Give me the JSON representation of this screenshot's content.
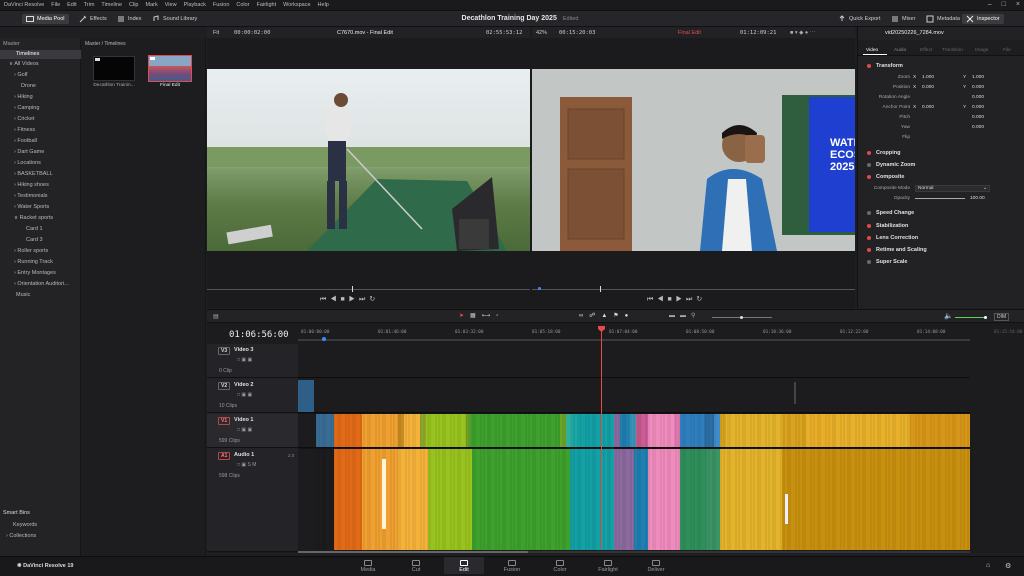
{
  "app": {
    "name": "DaVinci Resolve"
  },
  "menu": [
    "DaVinci Resolve",
    "File",
    "Edit",
    "Trim",
    "Timeline",
    "Clip",
    "Mark",
    "View",
    "Playback",
    "Fusion",
    "Color",
    "Fairlight",
    "Workspace",
    "Help"
  ],
  "toolbar": {
    "media_pool": "Media Pool",
    "effects": "Effects",
    "index": "Index",
    "sound_library": "Sound Library",
    "quick_export": "Quick Export",
    "mixer": "Mixer",
    "metadata": "Metadata",
    "inspector": "Inspector"
  },
  "project": {
    "title": "Decathlon Training Day 2025",
    "status": "Edited"
  },
  "leftpanel": {
    "header": "Master",
    "items": [
      "Timelines",
      "All Videos",
      "Golf",
      "Drone",
      "Hiking",
      "Camping",
      "Cricket",
      "Fitness",
      "Football",
      "Dart Game",
      "Locations",
      "BASKETBALL",
      "Hiking shoes",
      "Testimonials",
      "Water Sports",
      "Racket sports",
      "Card 1",
      "Card 3",
      "Roller sports",
      "Running Track",
      "Entry Montages",
      "Orientation Auditori...",
      "Music"
    ],
    "smart_bins": "Smart Bins",
    "smart_items": [
      "Keywords",
      "Collections"
    ]
  },
  "mediapool": {
    "breadcrumb": "Master / Timelines",
    "clips": [
      "Decathlon Trainin...",
      "Final Edit"
    ]
  },
  "source_viewer": {
    "zoom": "Fit",
    "timecode_left": "00:00:02:00",
    "clip_name": "C7670.mov - Final Edit",
    "timecode_right": "02:55:53:12"
  },
  "timeline_viewer": {
    "zoom": "42%",
    "timecode_left": "00:15:20:03",
    "timeline_name": "Final Edit",
    "timecode_right": "01:12:09:21"
  },
  "poster_text": [
    "WATE",
    "ECOS",
    "2025"
  ],
  "inspector": {
    "filename": "vid20250226_7284.mov",
    "tabs": [
      "Video",
      "Audio",
      "Effect",
      "Transition",
      "Image",
      "File"
    ],
    "sections": [
      "Transform",
      "Cropping",
      "Dynamic Zoom",
      "Composite",
      "Speed Change",
      "Stabilization",
      "Lens Correction",
      "Retime and Scaling",
      "Super Scale"
    ],
    "transform": {
      "zoom_label": "Zoom",
      "zoom_x": "1.000",
      "zoom_y": "1.000",
      "position_label": "Position",
      "pos_x": "0.000",
      "pos_y": "0.000",
      "rotation_label": "Rotation Angle",
      "rotation": "0.000",
      "anchor_label": "Anchor Point",
      "anchor_x": "0.000",
      "anchor_y": "0.000",
      "pitch_label": "Pitch",
      "pitch": "0.000",
      "yaw_label": "Yaw",
      "yaw": "0.000",
      "flip_label": "Flip",
      "x": "X",
      "y": "Y"
    },
    "composite": {
      "mode_label": "Composite Mode",
      "mode": "Normal",
      "opacity_label": "Opacity",
      "opacity": "100.00"
    }
  },
  "timeline": {
    "timecode": "01:06:56:00",
    "ruler": [
      "01:00:00:00",
      "01:01:46:00",
      "01:03:32:00",
      "01:05:18:00",
      "01:07:04:00",
      "01:08:50:00",
      "01:10:36:00",
      "01:12:22:00",
      "01:14:08:00",
      "01:15:54:00"
    ],
    "tracks": [
      {
        "id": "V3",
        "name": "Video 3",
        "count": "0 Clip"
      },
      {
        "id": "V2",
        "name": "Video 2",
        "count": "10 Clips"
      },
      {
        "id": "V1",
        "name": "Video 1",
        "count": "599 Clips"
      },
      {
        "id": "A1",
        "name": "Audio 1",
        "count": "598 Clips",
        "level": "2.0"
      }
    ],
    "dim_label": "DIM"
  },
  "pages": [
    "Media",
    "Cut",
    "Edit",
    "Fusion",
    "Color",
    "Fairlight",
    "Deliver"
  ],
  "active_page": "Edit",
  "footer_app": "DaVinci Resolve 19",
  "colors": {
    "accent": "#e64b4b",
    "playhead": "#e64b4b"
  }
}
